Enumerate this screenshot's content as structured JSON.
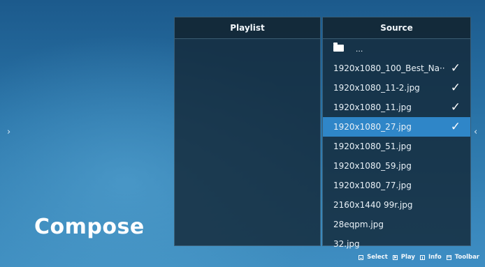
{
  "screen_title": "Compose",
  "nav": {
    "left_arrow": "›",
    "right_arrow": "‹"
  },
  "playlist": {
    "header": "Playlist",
    "items": []
  },
  "source": {
    "header": "Source",
    "folder_label": "...",
    "items": [
      {
        "label": "1920x1080_100_Best_Na··",
        "checked": true,
        "selected": false
      },
      {
        "label": "1920x1080_11-2.jpg",
        "checked": true,
        "selected": false
      },
      {
        "label": "1920x1080_11.jpg",
        "checked": true,
        "selected": false
      },
      {
        "label": "1920x1080_27.jpg",
        "checked": true,
        "selected": true
      },
      {
        "label": "1920x1080_51.jpg",
        "checked": false,
        "selected": false
      },
      {
        "label": "1920x1080_59.jpg",
        "checked": false,
        "selected": false
      },
      {
        "label": "1920x1080_77.jpg",
        "checked": false,
        "selected": false
      },
      {
        "label": "2160x1440  99r.jpg",
        "checked": false,
        "selected": false
      },
      {
        "label": "28eqpm.jpg",
        "checked": false,
        "selected": false
      },
      {
        "label": "32.jpg",
        "checked": false,
        "selected": false
      }
    ],
    "check_glyph": "✓"
  },
  "toolbar": {
    "select_label": "Select",
    "play_label": "Play",
    "info_label": "Info",
    "toolbar_label": "Toolbar"
  },
  "colors": {
    "selected_row": "#2f86c8",
    "panel_bg": "#142838"
  }
}
